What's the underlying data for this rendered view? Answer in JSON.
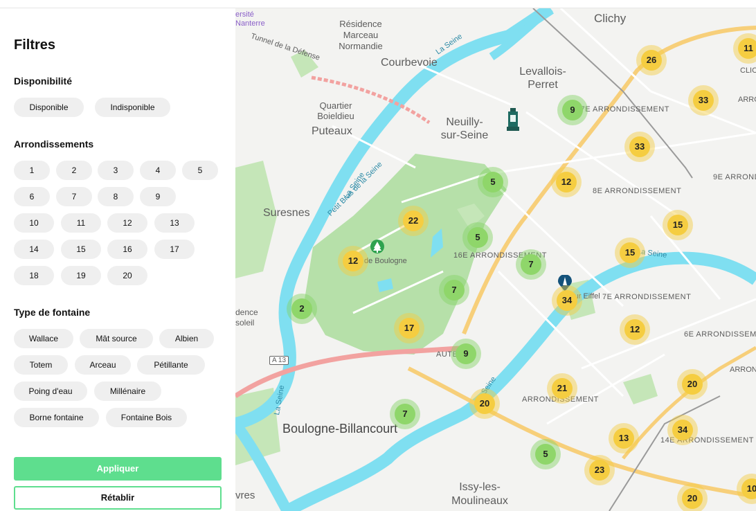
{
  "filters": {
    "title": "Filtres",
    "availability": {
      "heading": "Disponibilité",
      "options": [
        "Disponible",
        "Indisponible"
      ]
    },
    "arrondissements": {
      "heading": "Arrondissements",
      "options": [
        "1",
        "2",
        "3",
        "4",
        "5",
        "6",
        "7",
        "8",
        "9",
        "10",
        "11",
        "12",
        "13",
        "14",
        "15",
        "16",
        "17",
        "18",
        "19",
        "20"
      ]
    },
    "fountain_type": {
      "heading": "Type de fontaine",
      "options": [
        "Wallace",
        "Mât source",
        "Albien",
        "Totem",
        "Arceau",
        "Pétillante",
        "Poing d'eau",
        "Millénaire",
        "Borne fontaine",
        "Fontaine Bois"
      ]
    },
    "apply_label": "Appliquer",
    "reset_label": "Rétablir"
  },
  "map": {
    "colors": {
      "water": "#7fdff1",
      "park": "#b6e0a9",
      "road_major": "#f7cf7a",
      "highway": "#f2a2a0",
      "cluster_yellow": "#f5cd41",
      "cluster_green": "#8fd66a"
    },
    "place_labels": [
      "Clichy",
      "Levallois-Perret",
      "Courbevoie",
      "Neuilly-sur-Seine",
      "Puteaux",
      "Quartier Boieldieu",
      "Résidence Marceau Normandie",
      "Suresnes",
      "Boulogne-Billancourt",
      "Issy-les-Moulineaux",
      "La Seine",
      "Petit Bras de la Seine",
      "17E ARRONDISSEMENT",
      "8E ARRONDISSEMENT",
      "16E ARRONDISSEMENT",
      "7E ARRONDISSEMENT",
      "6E ARRONDISSEMENT",
      "9E ARRONDISSEMENT",
      "14E ARRONDISSEMENT",
      "ARRONDISSEMENT",
      "AUTEUIL",
      "de Boulogne",
      "Tour Eiffel",
      "Tunnel de la Défense",
      "A 13",
      "CLIC",
      "ARRO",
      "ARRON",
      "ersité",
      "Nanterre",
      "dence",
      "soleil",
      "vres"
    ],
    "clusters": [
      {
        "count": "26",
        "color": "yellow"
      },
      {
        "count": "11",
        "color": "yellow"
      },
      {
        "count": "33",
        "color": "yellow"
      },
      {
        "count": "9",
        "color": "green"
      },
      {
        "count": "33",
        "color": "yellow"
      },
      {
        "count": "12",
        "color": "yellow"
      },
      {
        "count": "5",
        "color": "green"
      },
      {
        "count": "22",
        "color": "yellow"
      },
      {
        "count": "5",
        "color": "green"
      },
      {
        "count": "15",
        "color": "yellow"
      },
      {
        "count": "15",
        "color": "yellow"
      },
      {
        "count": "12",
        "color": "yellow"
      },
      {
        "count": "7",
        "color": "green"
      },
      {
        "count": "7",
        "color": "green"
      },
      {
        "count": "34",
        "color": "yellow"
      },
      {
        "count": "2",
        "color": "green"
      },
      {
        "count": "17",
        "color": "yellow"
      },
      {
        "count": "12",
        "color": "yellow"
      },
      {
        "count": "9",
        "color": "green"
      },
      {
        "count": "21",
        "color": "yellow"
      },
      {
        "count": "20",
        "color": "yellow"
      },
      {
        "count": "20",
        "color": "yellow"
      },
      {
        "count": "7",
        "color": "green"
      },
      {
        "count": "34",
        "color": "yellow"
      },
      {
        "count": "13",
        "color": "yellow"
      },
      {
        "count": "5",
        "color": "green"
      },
      {
        "count": "23",
        "color": "yellow"
      },
      {
        "count": "20",
        "color": "yellow"
      },
      {
        "count": "10",
        "color": "yellow"
      }
    ],
    "pois": [
      "tree-marker-icon",
      "monument-marker-icon",
      "eiffel-tower-marker-icon"
    ]
  }
}
